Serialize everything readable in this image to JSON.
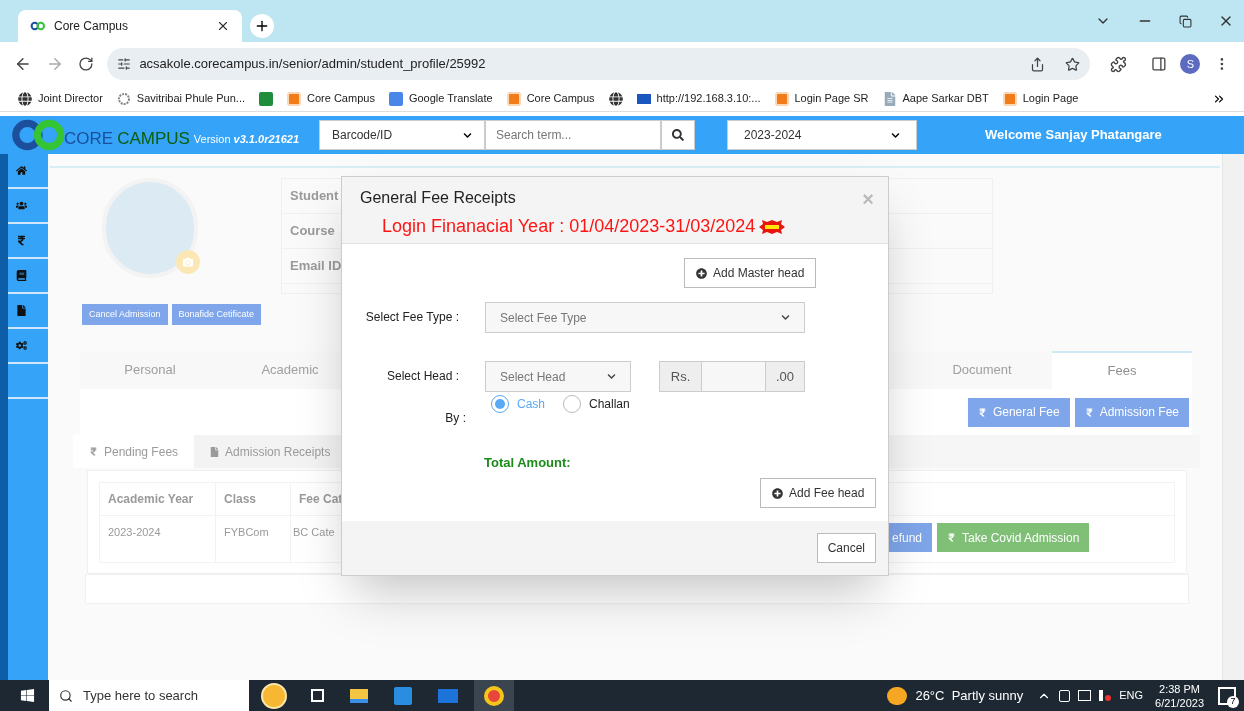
{
  "browser": {
    "tab_title": "Core Campus",
    "url": "acsakole.corecampus.in/senior/admin/student_profile/25992",
    "profile_initial": "S",
    "bookmarks": [
      {
        "kind": "globe",
        "label": "Joint Director"
      },
      {
        "kind": "emblem",
        "label": "Savitribai Phule Pun..."
      },
      {
        "kind": "sheet"
      },
      {
        "kind": "campus",
        "label": "Core Campus"
      },
      {
        "kind": "translate",
        "label": "Google Translate"
      },
      {
        "kind": "campus",
        "label": "Core Campus"
      },
      {
        "kind": "globe"
      },
      {
        "kind": "dsm",
        "label": "http://192.168.3.10:..."
      },
      {
        "kind": "campus",
        "label": "Login Page SR"
      },
      {
        "kind": "doc",
        "label": "Aape Sarkar DBT"
      },
      {
        "kind": "campus",
        "label": "Login Page"
      }
    ]
  },
  "app_header": {
    "brand_core": "CORE",
    "brand_campus": "CAMPUS",
    "version_label": "Version",
    "version": "v3.1.0r21621",
    "search_by": "Barcode/ID",
    "search_placeholder": "Search term...",
    "year": "2023-2024",
    "welcome": "Welcome Sanjay Phatangare"
  },
  "sidebar": {
    "items": [
      {
        "kind": "home"
      },
      {
        "kind": "users"
      },
      {
        "kind": "rupee"
      },
      {
        "kind": "book"
      },
      {
        "kind": "file"
      },
      {
        "kind": "cogs"
      },
      {
        "kind": "blank"
      }
    ]
  },
  "page": {
    "info_labels": [
      "Student",
      "Course",
      "Email ID"
    ],
    "action_buttons": [
      "Cancel Admission",
      "Bonafide Cetificate"
    ],
    "tabs": [
      {
        "label": "Personal",
        "selected": false
      },
      {
        "label": "Academic",
        "selected": false
      },
      {
        "label": "Document",
        "selected": false
      },
      {
        "label": "Fees",
        "selected": true
      }
    ],
    "fee_buttons": [
      "General Fee",
      "Admission Fee"
    ],
    "subtabs": [
      {
        "kind": "rupee",
        "label": "Pending Fees",
        "selected": true
      },
      {
        "kind": "file",
        "label": "Admission Receipts",
        "selected": false
      }
    ],
    "table": {
      "columns": [
        "Academic Year",
        "Class",
        "Fee Cat"
      ],
      "rows": [
        [
          "2023-2024",
          "FYBCom",
          "BC Cate"
        ]
      ]
    },
    "row_buttons": [
      {
        "kind": "blue",
        "label": "efund"
      },
      {
        "kind": "green",
        "label": "Take Covid Admission"
      }
    ]
  },
  "modal": {
    "title": "General Fee Receipts",
    "subtitle": "Login Finanacial Year : 01/04/2023-31/03/2024",
    "close": "×",
    "add_master": "Add Master head",
    "fee_type_label": "Select Fee Type :",
    "fee_type_placeholder": "Select Fee Type",
    "head_label": "Select Head :",
    "head_placeholder": "Select Head",
    "rs": "Rs.",
    "paise": ".00",
    "by_label": "By :",
    "payment_options": [
      {
        "label": "Cash",
        "selected": true
      },
      {
        "label": "Challan",
        "selected": false
      }
    ],
    "total_label": "Total Amount:",
    "add_fee_head": "Add Fee head",
    "cancel": "Cancel"
  },
  "taskbar": {
    "search_placeholder": "Type here to search",
    "weather": "26°C  Partly sunny",
    "language": "ENG",
    "time": "2:38 PM",
    "date": "6/21/2023",
    "notifications": "7"
  }
}
